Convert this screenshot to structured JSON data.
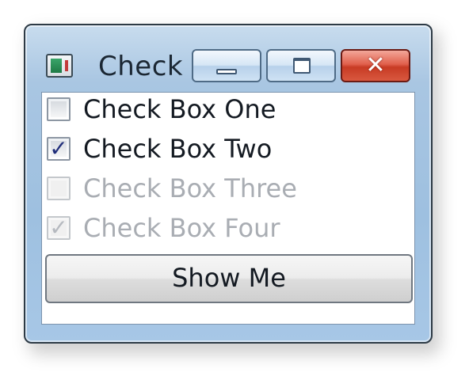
{
  "window": {
    "title": "Check",
    "controls": {
      "minimize": "minimize-icon",
      "maximize": "maximize-icon",
      "close": "close-icon",
      "close_glyph": "✕"
    }
  },
  "checkboxes": [
    {
      "label": "Check Box One",
      "checked": false,
      "enabled": true
    },
    {
      "label": "Check Box Two",
      "checked": true,
      "enabled": true
    },
    {
      "label": "Check Box Three",
      "checked": false,
      "enabled": false
    },
    {
      "label": "Check Box Four",
      "checked": true,
      "enabled": false
    }
  ],
  "check_glyph": "✓",
  "button": {
    "label": "Show Me"
  },
  "colors": {
    "close_button": "#d9583f",
    "check_mark": "#1f2d7a",
    "disabled_text": "#a9adb3"
  }
}
